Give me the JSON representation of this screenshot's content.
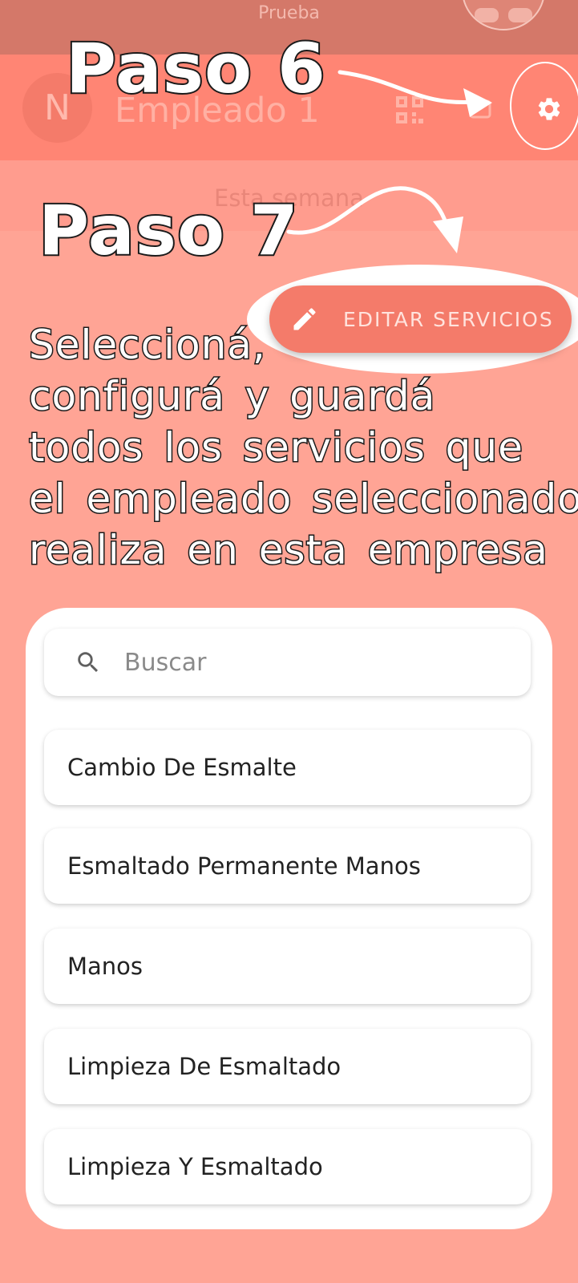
{
  "app": {
    "title": "Prueba"
  },
  "header": {
    "avatar_letter": "N",
    "employee_name": "Empleado 1"
  },
  "subheader": {
    "label": "Esta semana"
  },
  "annotations": {
    "step6": "Paso 6",
    "step7": "Paso 7",
    "instruction_lines": [
      "Seleccioná,",
      "configurá y guardá",
      "todos los servicios que",
      "el empleado seleccionado",
      "realiza en esta empresa"
    ]
  },
  "actions": {
    "edit_services_label": "EDITAR SERVICIOS"
  },
  "search": {
    "placeholder": "Buscar",
    "value": ""
  },
  "services": [
    "Cambio De Esmalte",
    "Esmaltado Permanente Manos",
    "Manos",
    "Limpieza De Esmaltado",
    "Limpieza Y Esmaltado"
  ],
  "colors": {
    "background": "#FFA495",
    "header": "#FF8574",
    "accent": "#F47B6A",
    "topbar": "#D47869"
  },
  "icons": [
    "qr-code-icon",
    "settings-gear-icon",
    "pencil-icon",
    "search-icon"
  ]
}
